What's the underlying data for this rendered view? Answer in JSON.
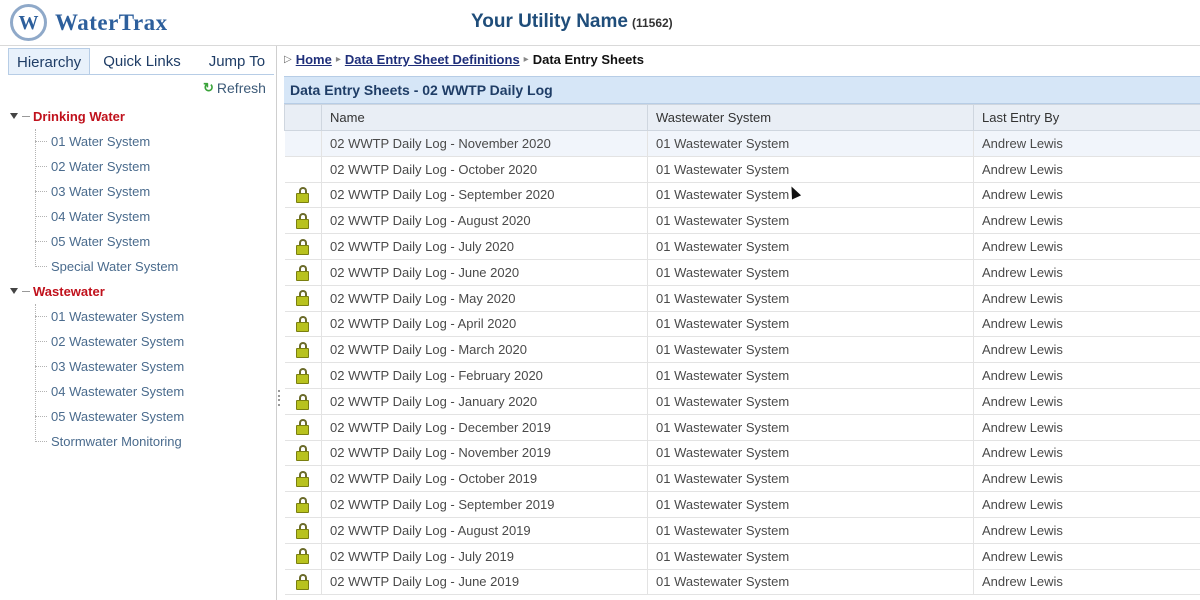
{
  "header": {
    "logo_letter": "W",
    "logo_text": "WaterTrax",
    "utility_name": "Your Utility Name",
    "utility_id": "(11562)"
  },
  "left": {
    "tabs": [
      {
        "label": "Hierarchy"
      },
      {
        "label": "Quick Links"
      },
      {
        "label": "Jump To"
      }
    ],
    "refresh_label": "Refresh",
    "tree": [
      {
        "label": "Drinking Water",
        "children": [
          "01 Water System",
          "02 Water System",
          "03 Water System",
          "04 Water System",
          "05 Water System",
          "Special Water System"
        ]
      },
      {
        "label": "Wastewater",
        "children": [
          "01 Wastewater System",
          "02 Wastewater System",
          "03 Wastewater System",
          "04 Wastewater System",
          "05 Wastewater System",
          "Stormwater Monitoring"
        ]
      }
    ]
  },
  "breadcrumb": {
    "home": "Home",
    "definitions": "Data Entry Sheet Definitions",
    "current": "Data Entry Sheets"
  },
  "panel_title": "Data Entry Sheets - 02 WWTP Daily Log",
  "grid": {
    "columns": [
      "",
      "Name",
      "Wastewater System",
      "Last Entry By"
    ],
    "rows": [
      {
        "locked": false,
        "name": "02 WWTP Daily Log - November 2020",
        "system": "01 Wastewater System",
        "last_entry_by": "Andrew Lewis"
      },
      {
        "locked": false,
        "name": "02 WWTP Daily Log - October 2020",
        "system": "01 Wastewater System",
        "last_entry_by": "Andrew Lewis"
      },
      {
        "locked": true,
        "name": "02 WWTP Daily Log - September 2020",
        "system": "01 Wastewater System",
        "last_entry_by": "Andrew Lewis"
      },
      {
        "locked": true,
        "name": "02 WWTP Daily Log - August 2020",
        "system": "01 Wastewater System",
        "last_entry_by": "Andrew Lewis"
      },
      {
        "locked": true,
        "name": "02 WWTP Daily Log - July 2020",
        "system": "01 Wastewater System",
        "last_entry_by": "Andrew Lewis"
      },
      {
        "locked": true,
        "name": "02 WWTP Daily Log - June 2020",
        "system": "01 Wastewater System",
        "last_entry_by": "Andrew Lewis"
      },
      {
        "locked": true,
        "name": "02 WWTP Daily Log - May 2020",
        "system": "01 Wastewater System",
        "last_entry_by": "Andrew Lewis"
      },
      {
        "locked": true,
        "name": "02 WWTP Daily Log - April 2020",
        "system": "01 Wastewater System",
        "last_entry_by": "Andrew Lewis"
      },
      {
        "locked": true,
        "name": "02 WWTP Daily Log - March 2020",
        "system": "01 Wastewater System",
        "last_entry_by": "Andrew Lewis"
      },
      {
        "locked": true,
        "name": "02 WWTP Daily Log - February 2020",
        "system": "01 Wastewater System",
        "last_entry_by": "Andrew Lewis"
      },
      {
        "locked": true,
        "name": "02 WWTP Daily Log - January 2020",
        "system": "01 Wastewater System",
        "last_entry_by": "Andrew Lewis"
      },
      {
        "locked": true,
        "name": "02 WWTP Daily Log - December 2019",
        "system": "01 Wastewater System",
        "last_entry_by": "Andrew Lewis"
      },
      {
        "locked": true,
        "name": "02 WWTP Daily Log - November 2019",
        "system": "01 Wastewater System",
        "last_entry_by": "Andrew Lewis"
      },
      {
        "locked": true,
        "name": "02 WWTP Daily Log - October 2019",
        "system": "01 Wastewater System",
        "last_entry_by": "Andrew Lewis"
      },
      {
        "locked": true,
        "name": "02 WWTP Daily Log - September 2019",
        "system": "01 Wastewater System",
        "last_entry_by": "Andrew Lewis"
      },
      {
        "locked": true,
        "name": "02 WWTP Daily Log - August 2019",
        "system": "01 Wastewater System",
        "last_entry_by": "Andrew Lewis"
      },
      {
        "locked": true,
        "name": "02 WWTP Daily Log - July 2019",
        "system": "01 Wastewater System",
        "last_entry_by": "Andrew Lewis"
      },
      {
        "locked": true,
        "name": "02 WWTP Daily Log - June 2019",
        "system": "01 Wastewater System",
        "last_entry_by": "Andrew Lewis"
      }
    ]
  },
  "colors": {
    "brand": "#2d5f9c",
    "category_red": "#c0111c",
    "panel_header_bg": "#d6e6f7",
    "lock_fill": "#b8c21e"
  }
}
